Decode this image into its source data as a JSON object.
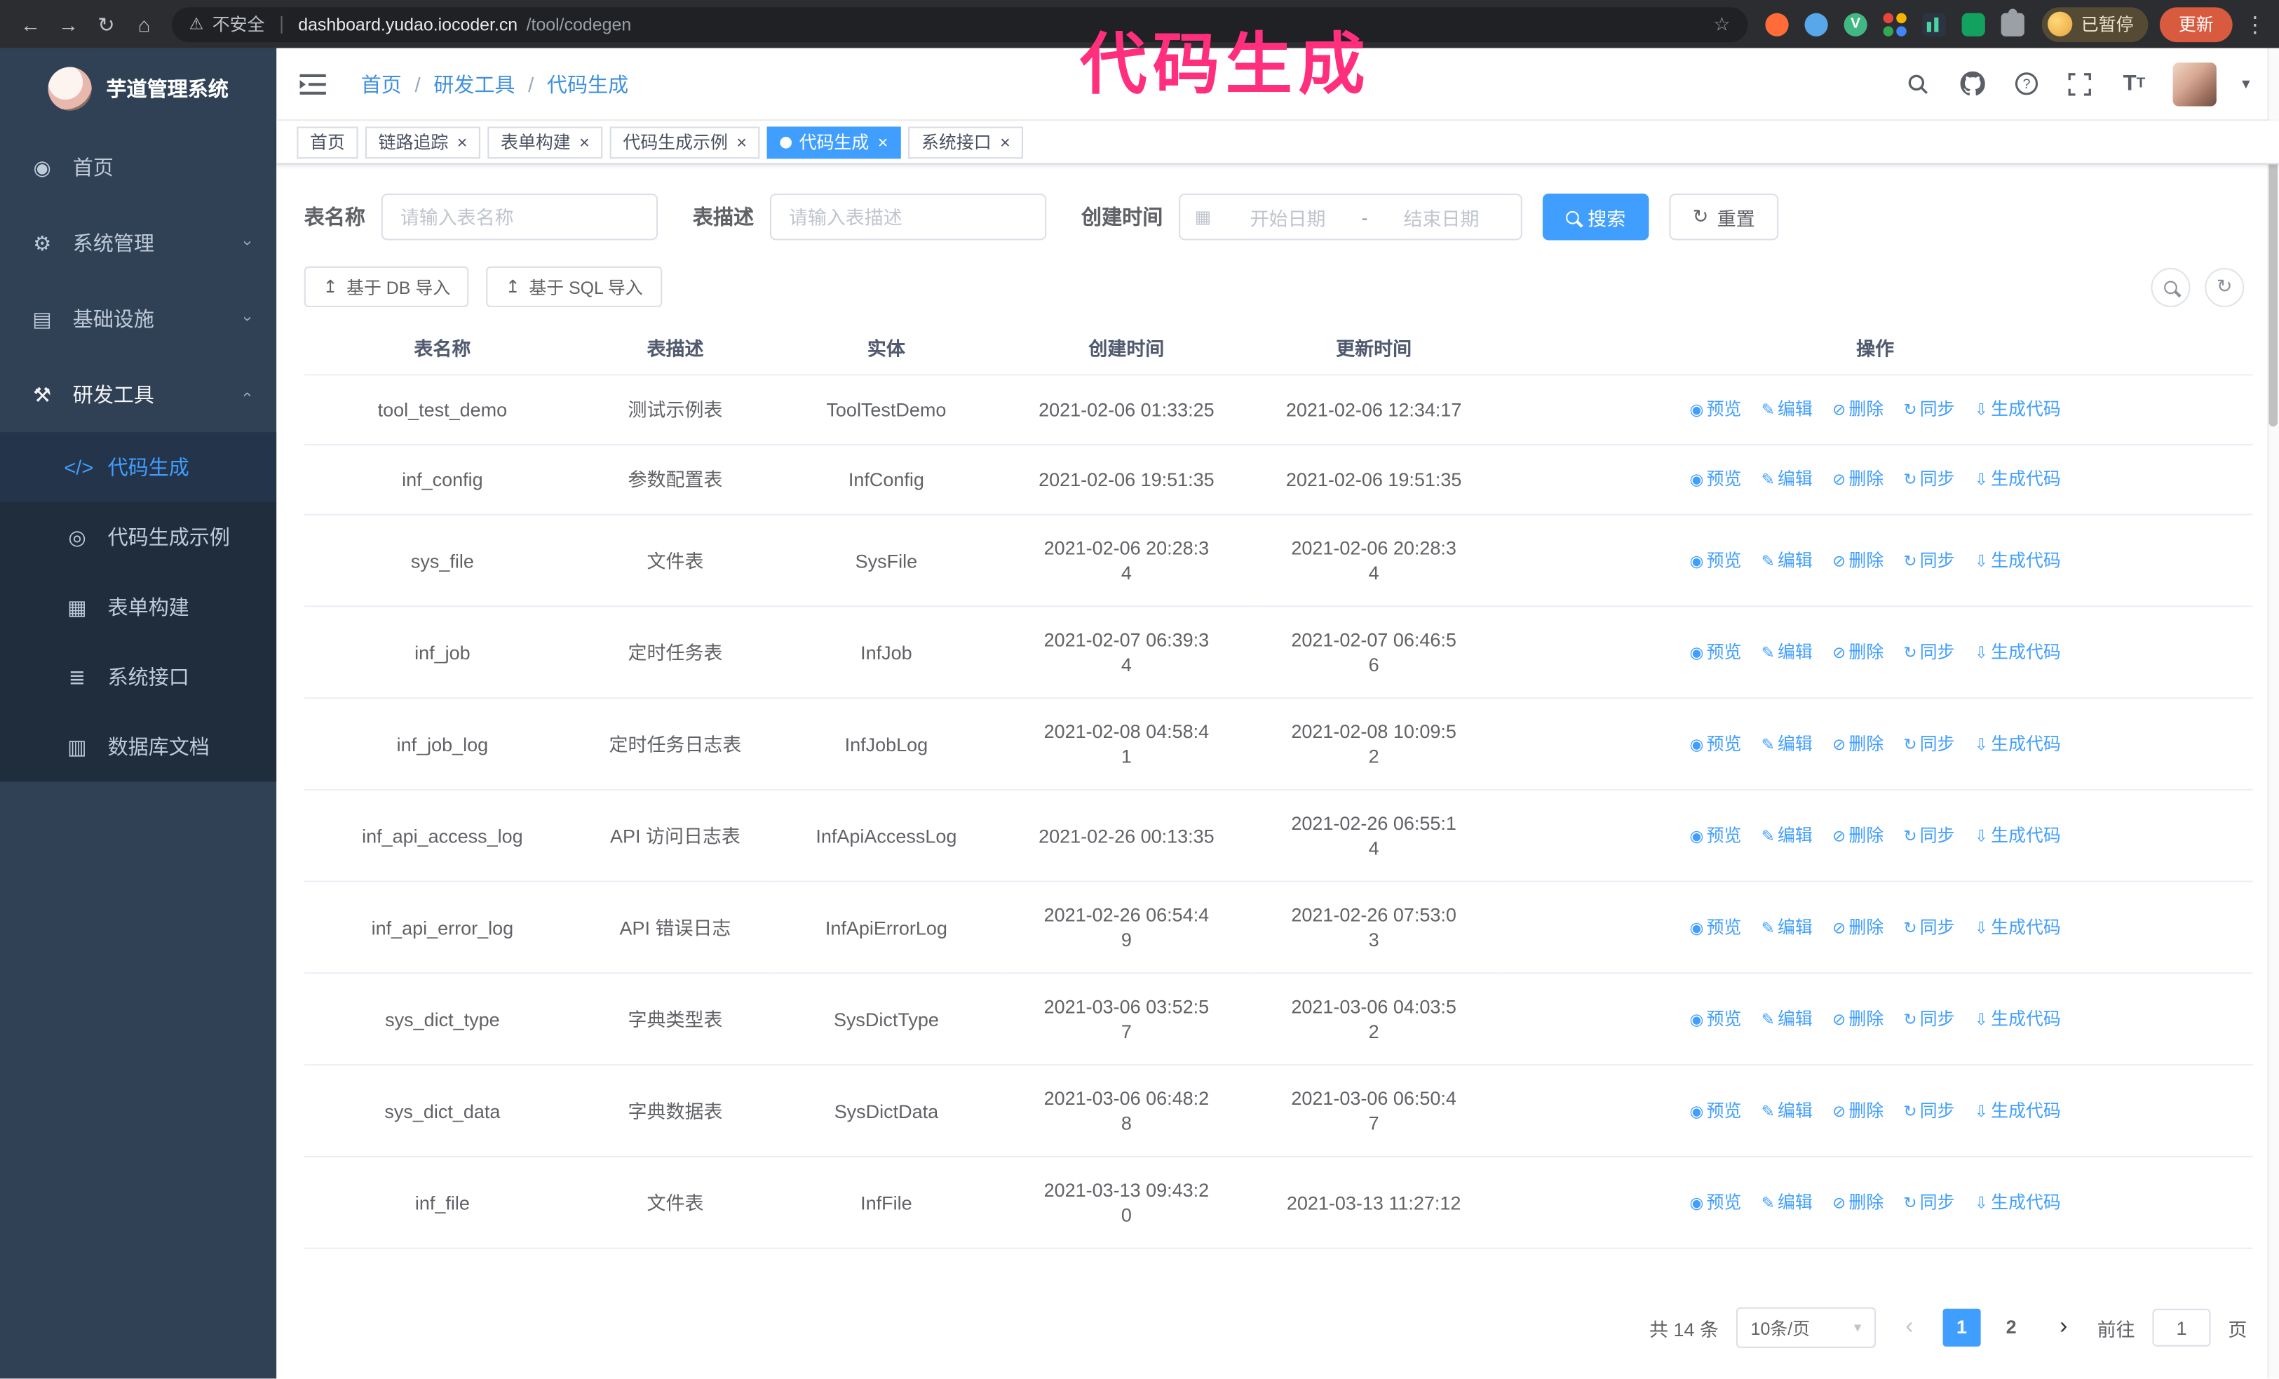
{
  "annotation": {
    "text": "代码生成"
  },
  "browser": {
    "security_warning": "不安全",
    "url_domain": "dashboard.yudao.iocoder.cn",
    "url_path": "/tool/codegen",
    "profile_chip": "已暂停",
    "update_button": "更新"
  },
  "sidebar": {
    "logo_title": "芋道管理系统",
    "menu": [
      {
        "icon": "◉",
        "icon_name": "dashboard-icon",
        "label": "首页",
        "expandable": false,
        "expanded": false
      },
      {
        "icon": "⚙",
        "icon_name": "gear-icon",
        "label": "系统管理",
        "expandable": true,
        "expanded": false
      },
      {
        "icon": "▤",
        "icon_name": "infrastructure-icon",
        "label": "基础设施",
        "expandable": true,
        "expanded": false
      },
      {
        "icon": "⚒",
        "icon_name": "devtools-icon",
        "label": "研发工具",
        "expandable": true,
        "expanded": true
      }
    ],
    "submenu": [
      {
        "icon": "</>",
        "icon_name": "code-icon",
        "label": "代码生成",
        "active": true
      },
      {
        "icon": "◎",
        "icon_name": "code-example-icon",
        "label": "代码生成示例",
        "active": false
      },
      {
        "icon": "▦",
        "icon_name": "form-builder-icon",
        "label": "表单构建",
        "active": false
      },
      {
        "icon": "≣",
        "icon_name": "api-icon",
        "label": "系统接口",
        "active": false
      },
      {
        "icon": "▥",
        "icon_name": "database-doc-icon",
        "label": "数据库文档",
        "active": false
      }
    ]
  },
  "header": {
    "breadcrumb": [
      "首页",
      "研发工具",
      "代码生成"
    ],
    "breadcrumb_separator": "/"
  },
  "tabs": [
    {
      "label": "首页",
      "closable": false,
      "active": false
    },
    {
      "label": "链路追踪",
      "closable": true,
      "active": false
    },
    {
      "label": "表单构建",
      "closable": true,
      "active": false
    },
    {
      "label": "代码生成示例",
      "closable": true,
      "active": false
    },
    {
      "label": "代码生成",
      "closable": true,
      "active": true
    },
    {
      "label": "系统接口",
      "closable": true,
      "active": false
    }
  ],
  "filters": {
    "table_name_label": "表名称",
    "table_name_placeholder": "请输入表名称",
    "table_desc_label": "表描述",
    "table_desc_placeholder": "请输入表描述",
    "create_time_label": "创建时间",
    "date_start_placeholder": "开始日期",
    "date_range_separator": "-",
    "date_end_placeholder": "结束日期",
    "search_button": "搜索",
    "reset_button": "重置"
  },
  "toolbar": {
    "import_db_button": "基于 DB 导入",
    "import_sql_button": "基于 SQL 导入"
  },
  "table": {
    "columns": [
      "表名称",
      "表描述",
      "实体",
      "创建时间",
      "更新时间",
      "操作"
    ],
    "actions": [
      {
        "icon": "◉",
        "label": "预览"
      },
      {
        "icon": "✎",
        "label": "编辑"
      },
      {
        "icon": "⊘",
        "label": "删除"
      },
      {
        "icon": "↻",
        "label": "同步"
      },
      {
        "icon": "⇩",
        "label": "生成代码"
      }
    ],
    "rows": [
      {
        "name": "tool_test_demo",
        "desc": "测试示例表",
        "entity": "ToolTestDemo",
        "created": "2021-02-06 01:33:25",
        "updated": "2021-02-06 12:34:17"
      },
      {
        "name": "inf_config",
        "desc": "参数配置表",
        "entity": "InfConfig",
        "created": "2021-02-06 19:51:35",
        "updated": "2021-02-06 19:51:35"
      },
      {
        "name": "sys_file",
        "desc": "文件表",
        "entity": "SysFile",
        "created": "2021-02-06 20:28:3\n4",
        "updated": "2021-02-06 20:28:3\n4"
      },
      {
        "name": "inf_job",
        "desc": "定时任务表",
        "entity": "InfJob",
        "created": "2021-02-07 06:39:3\n4",
        "updated": "2021-02-07 06:46:5\n6"
      },
      {
        "name": "inf_job_log",
        "desc": "定时任务日志表",
        "entity": "InfJobLog",
        "created": "2021-02-08 04:58:4\n1",
        "updated": "2021-02-08 10:09:5\n2"
      },
      {
        "name": "inf_api_access_log",
        "desc": "API 访问日志表",
        "entity": "InfApiAccessLog",
        "created": "2021-02-26 00:13:35",
        "updated": "2021-02-26 06:55:1\n4"
      },
      {
        "name": "inf_api_error_log",
        "desc": "API 错误日志",
        "entity": "InfApiErrorLog",
        "created": "2021-02-26 06:54:4\n9",
        "updated": "2021-02-26 07:53:0\n3"
      },
      {
        "name": "sys_dict_type",
        "desc": "字典类型表",
        "entity": "SysDictType",
        "created": "2021-03-06 03:52:5\n7",
        "updated": "2021-03-06 04:03:5\n2"
      },
      {
        "name": "sys_dict_data",
        "desc": "字典数据表",
        "entity": "SysDictData",
        "created": "2021-03-06 06:48:2\n8",
        "updated": "2021-03-06 06:50:4\n7"
      },
      {
        "name": "inf_file",
        "desc": "文件表",
        "entity": "InfFile",
        "created": "2021-03-13 09:43:2\n0",
        "updated": "2021-03-13 11:27:12"
      }
    ]
  },
  "pagination": {
    "total_text": "共 14 条",
    "page_size": "10条/页",
    "pages": [
      {
        "n": "1",
        "active": true
      },
      {
        "n": "2",
        "active": false
      }
    ],
    "goto_label": "前往",
    "goto_value": "1",
    "goto_unit": "页"
  }
}
